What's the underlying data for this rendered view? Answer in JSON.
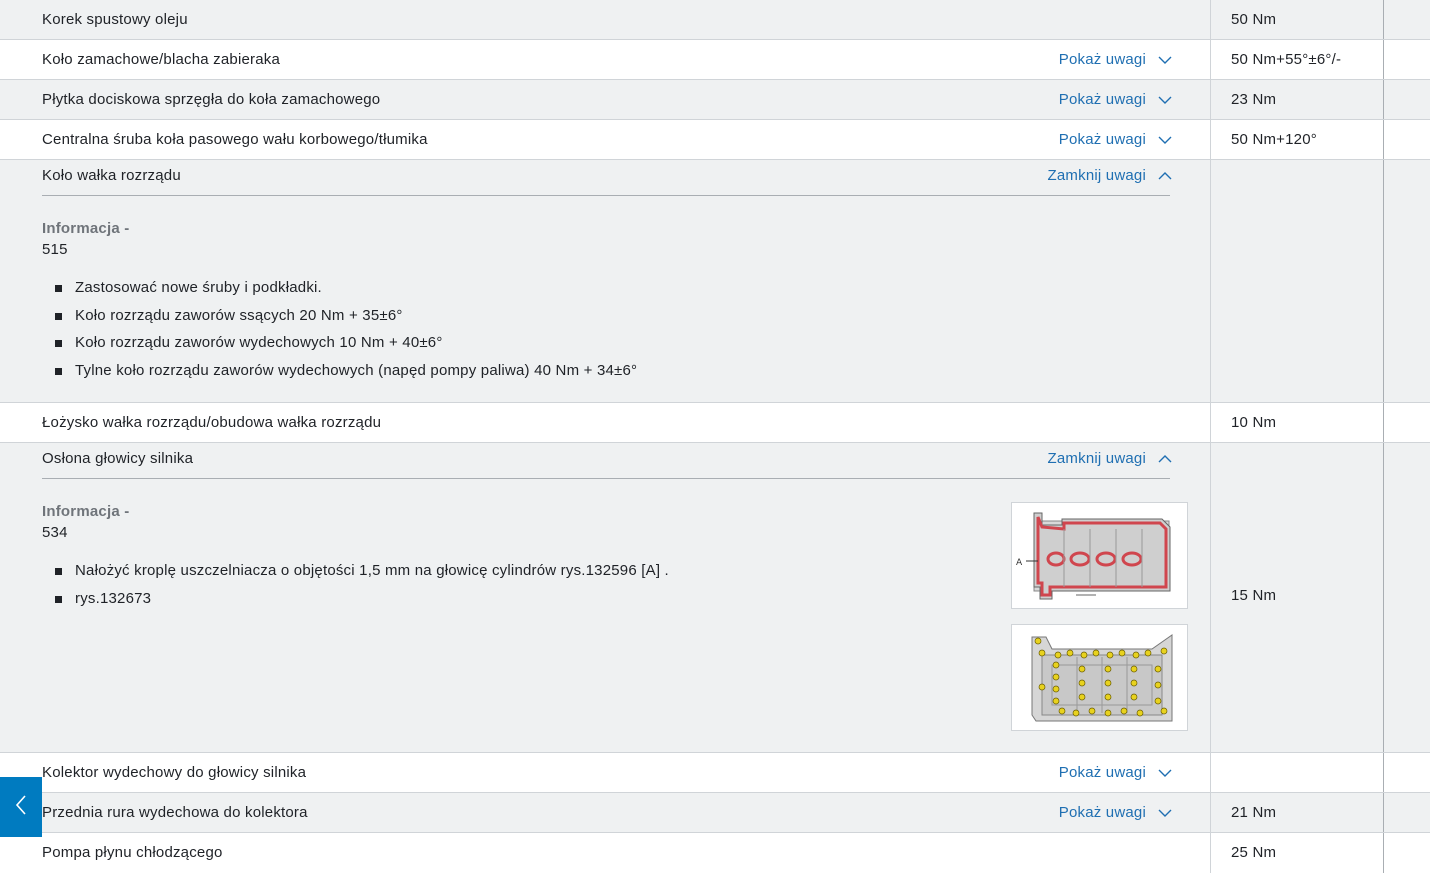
{
  "rows": [
    {
      "label": "Korek spustowy oleju",
      "toggle": "",
      "value": "50 Nm"
    },
    {
      "label": "Koło zamachowe/blacha zabieraka",
      "toggle": "Pokaż uwagi",
      "value": "50 Nm+55°±6°/-"
    },
    {
      "label": "Płytka dociskowa sprzęgła do koła zamachowego",
      "toggle": "Pokaż uwagi",
      "value": "23 Nm"
    },
    {
      "label": "Centralna śruba koła pasowego wału korbowego/tłumika",
      "toggle": "Pokaż uwagi",
      "value": "50 Nm+120°"
    }
  ],
  "expanded1": {
    "label": "Koło wałka rozrządu",
    "toggle": "Zamknij uwagi",
    "info_title": "Informacja -",
    "info_num": "515",
    "bullets": [
      "Zastosować nowe śruby i podkładki.",
      "Koło rozrządu zaworów ssących 20 Nm + 35±6°",
      "Koło rozrządu zaworów wydechowych 10 Nm + 40±6°",
      "Tylne koło rozrządu zaworów wydechowych (napęd pompy paliwa) 40 Nm + 34±6°"
    ],
    "value": ""
  },
  "row_bearing": {
    "label": "Łożysko wałka rozrządu/obudowa wałka rozrządu",
    "value": "10 Nm"
  },
  "expanded2": {
    "label": "Osłona głowicy silnika",
    "toggle": "Zamknij uwagi",
    "info_title": "Informacja -",
    "info_num": "534",
    "bullets": [
      "Nałożyć kroplę uszczelniacza o objętości 1,5 mm na głowicę cylindrów rys.132596 [A] .",
      "rys.132673"
    ],
    "image_callout": "A",
    "value": "15 Nm"
  },
  "rows_bottom": [
    {
      "label": "Kolektor wydechowy do głowicy silnika",
      "toggle": "Pokaż uwagi",
      "value": ""
    },
    {
      "label": "Przednia rura wydechowa do kolektora",
      "toggle": "Pokaż uwagi",
      "value": "21 Nm"
    },
    {
      "label": "Pompa płynu chłodzącego",
      "toggle": "",
      "value": "25 Nm"
    }
  ],
  "colors": {
    "link": "#1f6fb2",
    "accent": "#007bc0",
    "row_grey": "#eff1f2"
  },
  "icons": {
    "expand": "chevron-down-icon",
    "collapse": "chevron-up-icon",
    "nav": "chevron-left-icon"
  }
}
